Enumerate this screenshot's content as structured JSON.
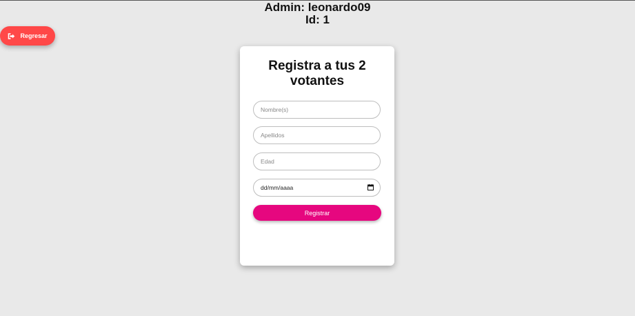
{
  "header": {
    "admin_line": "Admin: leonardo09",
    "id_line": "Id: 1"
  },
  "back_button": {
    "label": "Regresar",
    "icon": "sign-out-icon",
    "color": "#ff4848"
  },
  "form": {
    "title": "Registra a tus 2 votantes",
    "fields": {
      "nombre": {
        "placeholder": "Nombre(s)",
        "value": ""
      },
      "apellidos": {
        "placeholder": "Apellidos",
        "value": ""
      },
      "edad": {
        "placeholder": "Edad",
        "value": ""
      },
      "fecha": {
        "display": "dd/mm/aaaa",
        "icon": "calendar-icon"
      }
    },
    "submit_label": "Registrar",
    "submit_color": "#e6077f"
  }
}
